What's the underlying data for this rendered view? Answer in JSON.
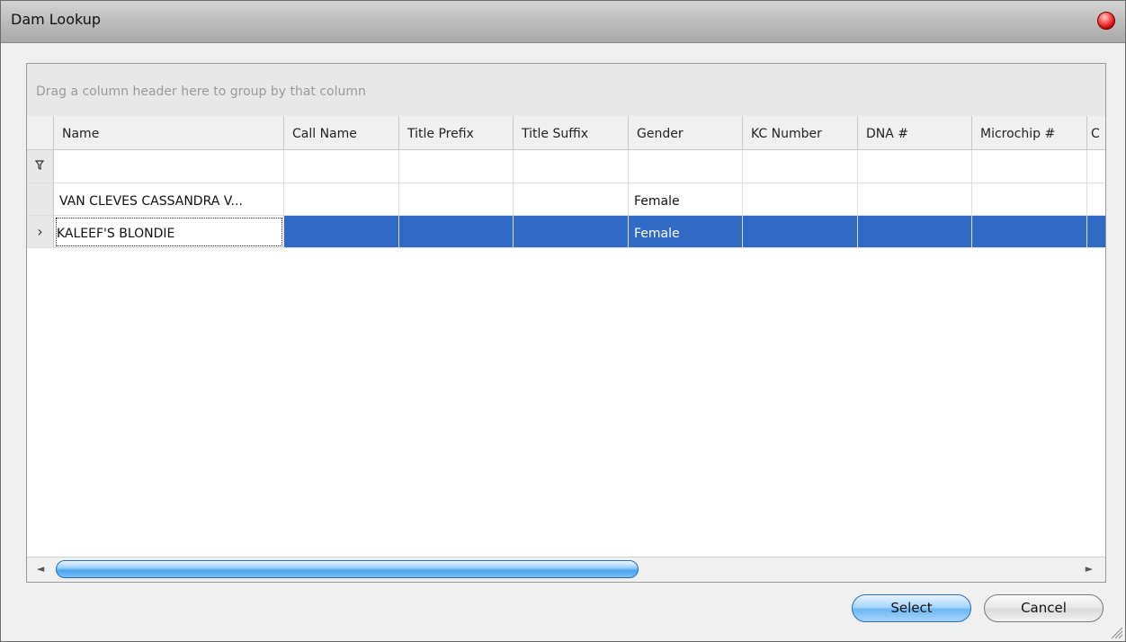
{
  "window": {
    "title": "Dam Lookup"
  },
  "grid": {
    "group_hint": "Drag a column header here to group by that column",
    "columns": [
      "Name",
      "Call Name",
      "Title Prefix",
      "Title Suffix",
      "Gender",
      "KC Number",
      "DNA #",
      "Microchip #",
      "C"
    ],
    "rows": [
      {
        "name": "VAN CLEVES CASSANDRA V...",
        "call_name": "",
        "title_prefix": "",
        "title_suffix": "",
        "gender": "Female",
        "kc_number": "",
        "dna": "",
        "microchip": "",
        "c": ""
      },
      {
        "name": "KALEEF'S BLONDIE",
        "call_name": "",
        "title_prefix": "",
        "title_suffix": "",
        "gender": "Female",
        "kc_number": "",
        "dna": "",
        "microchip": "",
        "c": "",
        "selected": true
      }
    ],
    "selected_row_indicator": "›",
    "filter_icon": "filter-icon",
    "scroll_left": "◄",
    "scroll_right": "►"
  },
  "buttons": {
    "select": "Select",
    "cancel": "Cancel"
  },
  "colors": {
    "selection": "#316ac5",
    "title_gradient": "#bfbfbf",
    "scroll_thumb": "#4aa4ee"
  }
}
